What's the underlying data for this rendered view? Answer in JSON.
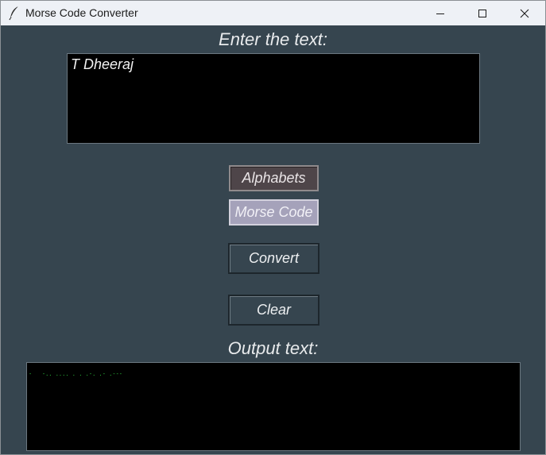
{
  "window": {
    "title": "Morse Code Converter",
    "app_icon": "feather-icon",
    "controls": {
      "minimize": "minimize-icon",
      "maximize": "maximize-icon",
      "close": "close-icon"
    }
  },
  "input": {
    "heading": "Enter the text:",
    "value": "T Dheeraj"
  },
  "mode_buttons": {
    "alphabets_label": "Alphabets",
    "morse_label": "Morse Code"
  },
  "actions": {
    "convert_label": "Convert",
    "clear_label": "Clear"
  },
  "output": {
    "heading": "Output text:",
    "value": "-   -.. .... . . .-. .- .---"
  },
  "colors": {
    "background": "#36454f",
    "textbox": "#000000",
    "output_text": "#2ecc40",
    "alphabets_button": "#4e4549",
    "morse_button": "#a5a2ba"
  }
}
